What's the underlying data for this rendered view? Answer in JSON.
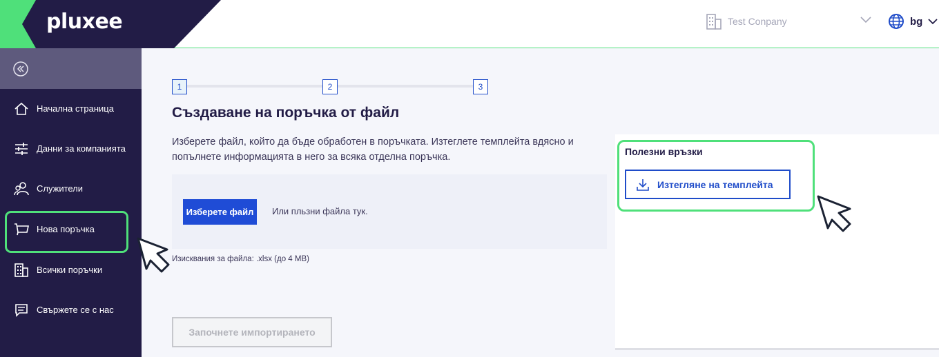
{
  "header": {
    "logo": "pluxee",
    "company": "Test Conpany",
    "language": "bg"
  },
  "sidebar": {
    "items": [
      {
        "label": "Начална страница",
        "icon": "home-icon"
      },
      {
        "label": "Данни за компанията",
        "icon": "sliders-icon"
      },
      {
        "label": "Служители",
        "icon": "users-icon"
      },
      {
        "label": "Нова поръчка",
        "icon": "cart-icon"
      },
      {
        "label": "Всички поръчки",
        "icon": "building-icon"
      },
      {
        "label": "Свържете се с нас",
        "icon": "message-icon"
      }
    ]
  },
  "stepper": {
    "steps": [
      "1",
      "2",
      "3"
    ],
    "active": 1
  },
  "main": {
    "title": "Създаване на поръчка от файл",
    "description": "Изберете файл, който да бъде обработен в поръчката. Изтеглете темплейта вдясно и попълнете информацията в него за всяка отделна поръчка.",
    "choose_file": "Изберете файл",
    "drop_hint": "Или пльзни файла тук.",
    "requirements": "Изисквания за файла: .xlsx (до 4 MB)",
    "start_import": "Започнете импортирането"
  },
  "links": {
    "title": "Полезни връзки",
    "download_template": "Изтегляне на темплейта"
  },
  "colors": {
    "navy": "#221c46",
    "accent_green": "#4fe07a",
    "primary_blue": "#1f4cd6"
  }
}
